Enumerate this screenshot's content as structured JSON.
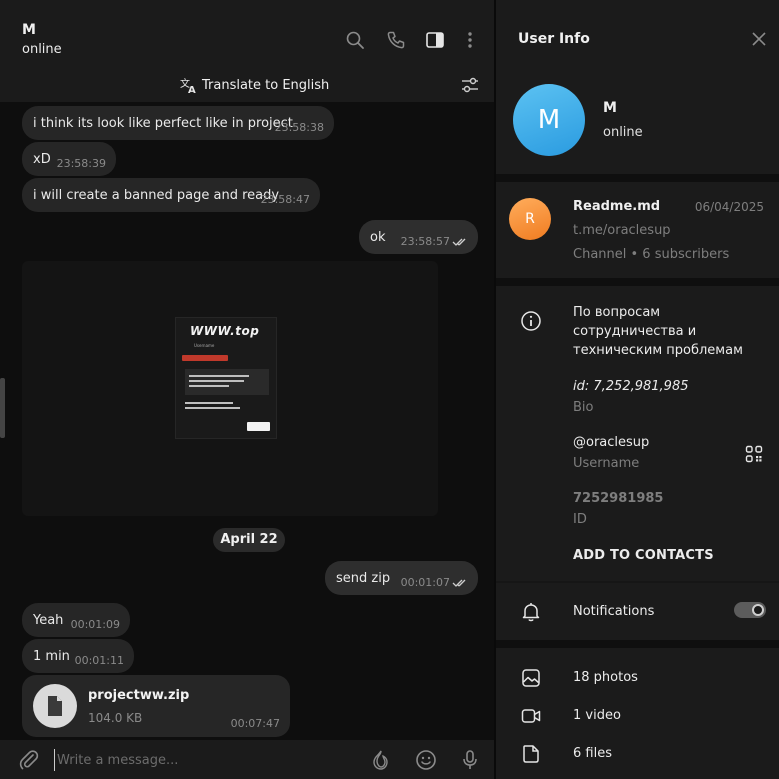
{
  "chat": {
    "title": "M",
    "status": "online",
    "translate_label": "Translate to English",
    "messages": [
      {
        "text": "i think its look like perfect like in project",
        "time": "23:58:38"
      },
      {
        "text": "xD",
        "time": "23:58:39"
      },
      {
        "text": "i will create a banned page and ready",
        "time": "23:58:47"
      },
      {
        "text": "ok",
        "time": "23:58:57"
      },
      {
        "text": "send zip",
        "time": "00:01:07"
      },
      {
        "text": "Yeah",
        "time": "00:01:09"
      },
      {
        "text": "1 min",
        "time": "00:01:11"
      }
    ],
    "image_preview": {
      "brand": "WWW.top",
      "username": "Username"
    },
    "date_chip": "April 22",
    "file": {
      "name": "projectww.zip",
      "size": "104.0 KB",
      "time": "00:07:47"
    },
    "composer_placeholder": "Write a message..."
  },
  "info": {
    "title": "User Info",
    "avatar_letter": "M",
    "name": "M",
    "status": "online",
    "channel": {
      "avatar_letter": "R",
      "name": "Readme.md",
      "date": "06/04/2025",
      "link": "t.me/oraclesup",
      "meta": "Channel • 6 subscribers"
    },
    "bio_text": "По вопросам сотрудничества и техническим проблемам",
    "bio_id": "id: 7,252,981,985",
    "bio_label": "Bio",
    "username_value": "@oraclesup",
    "username_label": "Username",
    "id_value": "7252981985",
    "id_label": "ID",
    "add_contacts": "ADD TO CONTACTS",
    "notifications_label": "Notifications",
    "notifications_on": true,
    "media": [
      {
        "label": "18 photos",
        "icon": "photo-icon"
      },
      {
        "label": "1 video",
        "icon": "video-icon"
      },
      {
        "label": "6 files",
        "icon": "file-icon"
      }
    ]
  },
  "colors": {
    "accent_blue": "#2a9be0",
    "channel_orange": "#f07c21",
    "bubble": "#262626",
    "panel": "#1b1b1b"
  }
}
